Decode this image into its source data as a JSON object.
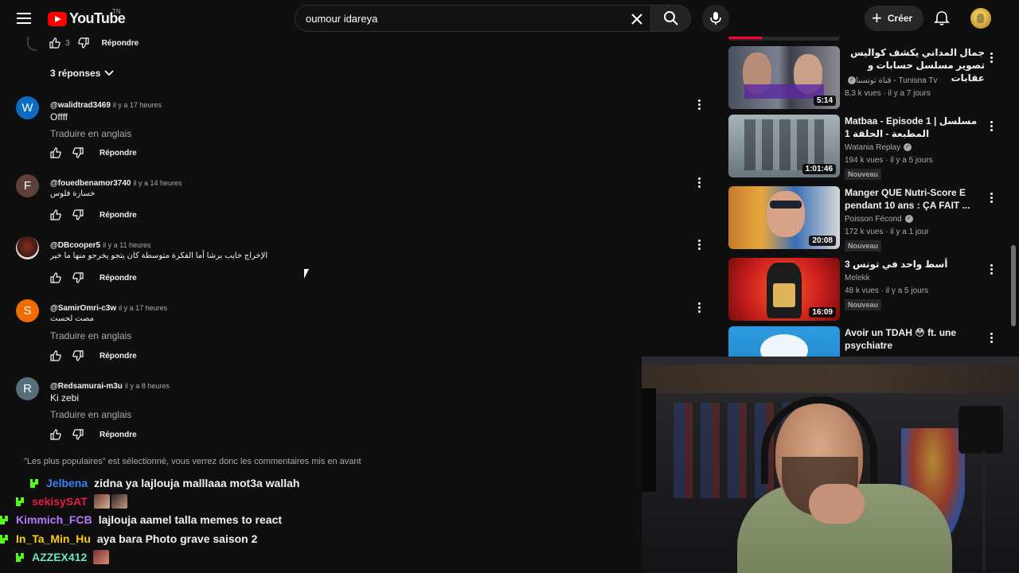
{
  "header": {
    "logo_text": "YouTube",
    "country": "TN",
    "search_value": "oumour idareya",
    "create_label": "Créer"
  },
  "comments": {
    "top_reply": {
      "likes": "3",
      "reply_label": "Répondre"
    },
    "replies_toggle": "3 réponses",
    "items": [
      {
        "author": "@walidtrad3469",
        "time": "il y a 17 heures",
        "text": "Offff",
        "translate": "Traduire en anglais",
        "reply_label": "Répondre",
        "avatar_letter": "W",
        "avatar_color": "#0b6cc2"
      },
      {
        "author": "@fouedbenamor3740",
        "time": "il y a 14 heures",
        "text": "خسارة فلوس",
        "reply_label": "Répondre",
        "avatar_letter": "F",
        "avatar_color": "#5d4037"
      },
      {
        "author": "@DBcooper5",
        "time": "il y a 11 heures",
        "text": "الإخراج خايب برشا أما الفكرة متوسطة كان يتجو يخرجو منها ما خير",
        "reply_label": "Répondre"
      },
      {
        "author": "@SamirOmri-c3w",
        "time": "il y a 17 heures",
        "text": "مصت لحست",
        "translate": "Traduire en anglais",
        "reply_label": "Répondre",
        "avatar_letter": "S",
        "avatar_color": "#ef6c00"
      },
      {
        "author": "@Redsamurai-m3u",
        "time": "il y a 8 heures",
        "text": "Ki zebi",
        "translate": "Traduire en anglais",
        "reply_label": "Répondre",
        "avatar_letter": "R",
        "avatar_color": "#546e7a"
      }
    ],
    "footer_note": "\"Les plus populaires\" est sélectionné, vous verrez donc les commentaires mis en avant"
  },
  "chat": [
    {
      "user": "Jelbena",
      "color": "#3b82f6",
      "message": "zidna ya lajlouja malllaaa mot3a wallah"
    },
    {
      "user": "sekisySAT",
      "color": "#e11d48",
      "message": ""
    },
    {
      "user": "Kimmich_FCB",
      "color": "#b57bff",
      "message": "lajlouja aamel talla memes to react"
    },
    {
      "user": "In_Ta_Min_Hu",
      "color": "#facc15",
      "message": "aya bara Photo grave saison 2"
    },
    {
      "user": "AZZEX412",
      "color": "#6ee7b7",
      "message": ""
    }
  ],
  "sidebar": {
    "videos": [
      {
        "title": "جمال المداني يكشف كواليس تصوير مسلسل حسابات و عقابات",
        "channel": "قناة تونسنا - Tunisna Tv",
        "verified": true,
        "meta": "8,3 k vues · il y a 7 jours",
        "duration": "5:14",
        "new": false,
        "rtl": true
      },
      {
        "title": "Matbaa - Episode 1 | مسلسل المطبعة - الحلقة 1",
        "channel": "Watania Replay",
        "verified": true,
        "meta": "194 k vues · il y a 5 jours",
        "duration": "1:01:46",
        "new": true,
        "new_label": "Nouveau"
      },
      {
        "title": "Manger QUE Nutri-Score E pendant 10 ans : ÇA FAIT ...",
        "channel": "Poisson Fécond",
        "verified": true,
        "meta": "172 k vues · il y a 1 jour",
        "duration": "20:08",
        "new": true,
        "new_label": "Nouveau"
      },
      {
        "title": "أسط واحد في تونس 3",
        "channel": "Melekk",
        "verified": false,
        "meta": "48 k vues · il y a 5 jours",
        "duration": "16:09",
        "new": true,
        "new_label": "Nouveau"
      },
      {
        "title": "Avoir un TDAH 😳 ft. une psychiatre",
        "channel": "",
        "verified": false,
        "meta": "",
        "duration": "",
        "new": false
      }
    ]
  }
}
